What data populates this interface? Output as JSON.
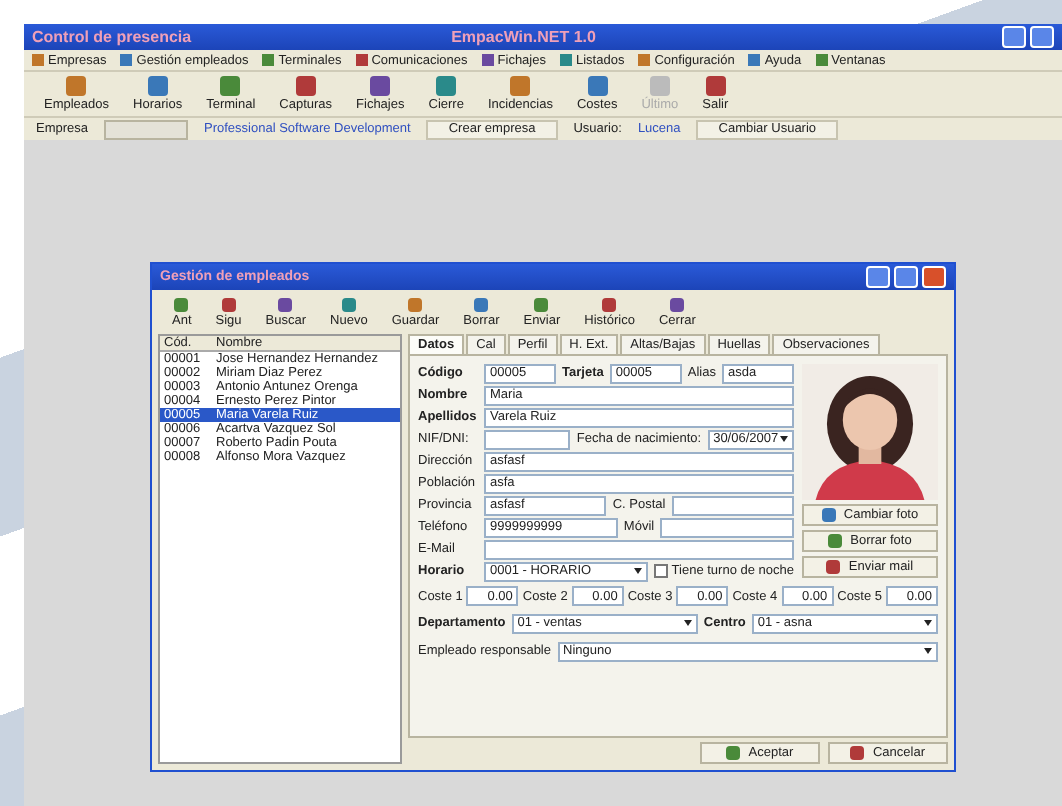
{
  "window": {
    "title": "Control de presencia",
    "app_name": "EmpacWin.NET 1.0"
  },
  "menu": [
    "Empresas",
    "Gestión empleados",
    "Terminales",
    "Comunicaciones",
    "Fichajes",
    "Listados",
    "Configuración",
    "Ayuda",
    "Ventanas"
  ],
  "toolbar": [
    {
      "label": "Empleados",
      "disabled": false
    },
    {
      "label": "Horarios",
      "disabled": false
    },
    {
      "label": "Terminal",
      "disabled": false
    },
    {
      "label": "Capturas",
      "disabled": false
    },
    {
      "label": "Fichajes",
      "disabled": false
    },
    {
      "label": "Cierre",
      "disabled": false
    },
    {
      "label": "Incidencias",
      "disabled": false
    },
    {
      "label": "Costes",
      "disabled": false
    },
    {
      "label": "Último",
      "disabled": true
    },
    {
      "label": "Salir",
      "disabled": false
    }
  ],
  "company_bar": {
    "empresa_label": "Empresa",
    "company_name": "Professional Software Development",
    "create_button": "Crear empresa",
    "user_label": "Usuario:",
    "user_value": "Lucena",
    "change_user_button": "Cambiar Usuario"
  },
  "dialog": {
    "title": "Gestión de empleados",
    "toolbar": [
      "Ant",
      "Sigu",
      "Buscar",
      "Nuevo",
      "Guardar",
      "Borrar",
      "Enviar",
      "Histórico",
      "Cerrar"
    ],
    "list": {
      "columns": [
        "Cód.",
        "Nombre"
      ],
      "rows": [
        {
          "code": "00001",
          "name": "Jose Hernandez Hernandez",
          "selected": false
        },
        {
          "code": "00002",
          "name": "Miriam Diaz Perez",
          "selected": false
        },
        {
          "code": "00003",
          "name": "Antonio Antunez Orenga",
          "selected": false
        },
        {
          "code": "00004",
          "name": "Ernesto Perez Pintor",
          "selected": false
        },
        {
          "code": "00005",
          "name": "Maria Varela Ruiz",
          "selected": true
        },
        {
          "code": "00006",
          "name": "Acartva Vazquez Sol",
          "selected": false
        },
        {
          "code": "00007",
          "name": "Roberto Padin Pouta",
          "selected": false
        },
        {
          "code": "00008",
          "name": "Alfonso Mora Vazquez",
          "selected": false
        }
      ]
    },
    "tabs": [
      {
        "label": "Datos",
        "selected": true
      },
      {
        "label": "Cal",
        "selected": false
      },
      {
        "label": "Perfil",
        "selected": false
      },
      {
        "label": "H. Ext.",
        "selected": false
      },
      {
        "label": "Altas/Bajas",
        "selected": false
      },
      {
        "label": "Huellas",
        "selected": false
      },
      {
        "label": "Observaciones",
        "selected": false
      }
    ],
    "form": [
      [
        {
          "kind": "label",
          "text": "Código",
          "bold": true
        },
        {
          "kind": "field",
          "text": "00005"
        },
        {
          "kind": "label",
          "text": "Tarjeta",
          "bold": true
        },
        {
          "kind": "field",
          "text": "00005"
        },
        {
          "kind": "label",
          "text": "Alias",
          "bold": false
        },
        {
          "kind": "field",
          "text": "asda"
        }
      ],
      [
        {
          "kind": "label",
          "text": "Nombre",
          "bold": true
        },
        {
          "kind": "field",
          "text": "Maria"
        }
      ],
      [
        {
          "kind": "label",
          "text": "Apellidos",
          "bold": true
        },
        {
          "kind": "field",
          "text": "Varela Ruiz"
        }
      ],
      [
        {
          "kind": "label",
          "text": "NIF/DNI:",
          "bold": false
        },
        {
          "kind": "field"
        },
        {
          "kind": "label",
          "text": "Fecha de nacimiento:",
          "bold": false
        },
        {
          "kind": "select",
          "text": "30/06/2007"
        }
      ],
      [
        {
          "kind": "label",
          "text": "Dirección",
          "bold": false
        },
        {
          "kind": "field",
          "text": "asfasf"
        }
      ],
      [
        {
          "kind": "label",
          "text": "Población",
          "bold": false
        },
        {
          "kind": "field",
          "text": "asfa"
        }
      ],
      [
        {
          "kind": "label",
          "text": "Provincia",
          "bold": false
        },
        {
          "kind": "field",
          "text": "asfasf"
        },
        {
          "kind": "label",
          "text": "C. Postal",
          "bold": false
        },
        {
          "kind": "field"
        }
      ],
      [
        {
          "kind": "label",
          "text": "Teléfono",
          "bold": false
        },
        {
          "kind": "field",
          "text": "9999999999"
        },
        {
          "kind": "label",
          "text": "Móvil",
          "bold": false
        },
        {
          "kind": "field"
        }
      ],
      [
        {
          "kind": "label",
          "text": "E-Mail",
          "bold": false
        },
        {
          "kind": "field"
        }
      ],
      [
        {
          "kind": "label",
          "text": "Horario",
          "bold": true
        },
        {
          "kind": "select",
          "text": "0001 - HORARIO"
        },
        {
          "kind": "checkbox",
          "text": "Tiene turno de noche",
          "checked": false
        }
      ]
    ],
    "photo_buttons": [
      "Cambiar foto",
      "Borrar foto",
      "Enviar mail"
    ],
    "costs": [
      {
        "label": "Coste 1",
        "value": "0.00"
      },
      {
        "label": "Coste 2",
        "value": "0.00"
      },
      {
        "label": "Coste 3",
        "value": "0.00"
      },
      {
        "label": "Coste 4",
        "value": "0.00"
      },
      {
        "label": "Coste 5",
        "value": "0.00"
      }
    ],
    "departamento": {
      "label": "Departamento",
      "value": "01 - ventas"
    },
    "centro": {
      "label": "Centro",
      "value": "01 - asna"
    },
    "responsable": {
      "label": "Empleado responsable",
      "value": "Ninguno"
    },
    "buttons": [
      "Aceptar",
      "Cancelar"
    ]
  }
}
